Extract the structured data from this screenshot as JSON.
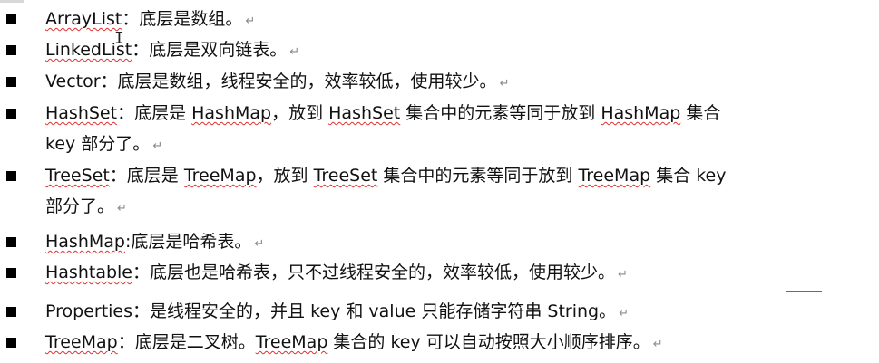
{
  "items": [
    {
      "lines": [
        [
          {
            "text": "ArrayList",
            "spell": true
          },
          {
            "text": "：底层是数组。",
            "spell": false
          },
          {
            "text": "↵",
            "ret": true
          }
        ]
      ]
    },
    {
      "lines": [
        [
          {
            "text": "LinkedList",
            "spell": true
          },
          {
            "text": "：底层是双向链表。",
            "spell": false
          },
          {
            "text": "↵",
            "ret": true
          }
        ]
      ]
    },
    {
      "lines": [
        [
          {
            "text": "Vector",
            "spell": false
          },
          {
            "text": "：底层是数组，线程安全的，效率较低，使用较少。",
            "spell": false
          },
          {
            "text": "↵",
            "ret": true
          }
        ]
      ]
    },
    {
      "lines": [
        [
          {
            "text": "HashSet",
            "spell": true
          },
          {
            "text": "：底层是 ",
            "spell": false
          },
          {
            "text": "HashMap",
            "spell": true
          },
          {
            "text": "，放到 ",
            "spell": false
          },
          {
            "text": "HashSet",
            "spell": true
          },
          {
            "text": " 集合中的元素等同于放到 ",
            "spell": false
          },
          {
            "text": "HashMap",
            "spell": true
          },
          {
            "text": " 集合",
            "spell": false
          }
        ],
        [
          {
            "text": "key 部分了。",
            "spell": false
          },
          {
            "text": "↵",
            "ret": true
          }
        ]
      ]
    },
    {
      "lines": [
        [
          {
            "text": "TreeSet",
            "spell": true
          },
          {
            "text": "：底层是 ",
            "spell": false
          },
          {
            "text": "TreeMap",
            "spell": true
          },
          {
            "text": "，放到 ",
            "spell": false
          },
          {
            "text": "TreeSet",
            "spell": true
          },
          {
            "text": " 集合中的元素等同于放到 ",
            "spell": false
          },
          {
            "text": "TreeMap",
            "spell": true
          },
          {
            "text": " 集合 key",
            "spell": false
          }
        ],
        [
          {
            "text": "部分了。",
            "spell": false
          },
          {
            "text": "↵",
            "ret": true
          }
        ]
      ]
    },
    {
      "lines": [
        [
          {
            "text": "HashMap",
            "spell": true
          },
          {
            "text": ":底层是哈希表。",
            "spell": false
          },
          {
            "text": "↵",
            "ret": true
          }
        ]
      ]
    },
    {
      "lines": [
        [
          {
            "text": "Hashtable",
            "spell": true
          },
          {
            "text": "：底层也是哈希表，只不过线程安全的，效率较低，使用较少。",
            "spell": false
          },
          {
            "text": "↵",
            "ret": true
          }
        ]
      ]
    },
    {
      "lines": [
        [
          {
            "text": "Properties",
            "spell": false
          },
          {
            "text": "：是线程安全的，并且 key 和 value 只能存储字符串 String。",
            "spell": false
          },
          {
            "text": "↵",
            "ret": true
          }
        ]
      ]
    },
    {
      "lines": [
        [
          {
            "text": "TreeMap",
            "spell": true
          },
          {
            "text": "：底层是二叉树。",
            "spell": false
          },
          {
            "text": "TreeMap",
            "spell": true
          },
          {
            "text": " 集合的 key 可以自动按照大小顺序排序。",
            "spell": false
          },
          {
            "text": "↵",
            "ret": true
          }
        ]
      ]
    }
  ],
  "icons": {
    "bullet": "square-bullet-icon",
    "cursor": "text-cursor-icon"
  },
  "colors": {
    "text": "#111111",
    "bullet": "#000000",
    "spellcheck": "#e03030",
    "paragraph_mark": "#8a8a8a"
  }
}
